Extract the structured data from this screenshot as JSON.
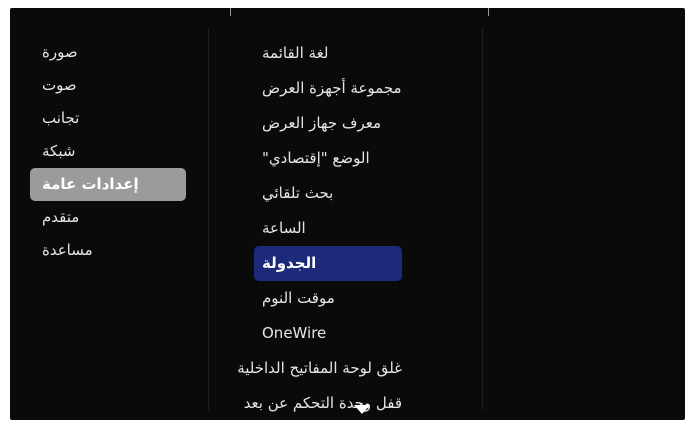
{
  "left_menu": {
    "items": [
      {
        "label": "صورة"
      },
      {
        "label": "صوت"
      },
      {
        "label": "تجانب"
      },
      {
        "label": "شبكة"
      },
      {
        "label": "إعدادات عامة",
        "selected": true
      },
      {
        "label": "متقدم"
      },
      {
        "label": "مساعدة"
      }
    ]
  },
  "submenu": {
    "items": [
      {
        "label": "لغة القائمة"
      },
      {
        "label": "مجموعة أجهزة العرض"
      },
      {
        "label": "معرف جهاز العرض"
      },
      {
        "label": "الوضع \"إقتصادي\""
      },
      {
        "label": "بحث تلقائي"
      },
      {
        "label": "الساعة"
      },
      {
        "label": "الجدولة",
        "selected": true
      },
      {
        "label": "موقت النوم"
      },
      {
        "label": "OneWire"
      },
      {
        "label": "غلق لوحة المفاتيح الداخلية"
      },
      {
        "label": "قفل وحدة التحكم عن بعد"
      }
    ],
    "more_icon": "chevron-down-icon"
  },
  "colors": {
    "background": "#0a0a0a",
    "left_selected": "#9b9b9b",
    "sub_selected": "#1d2a7a",
    "text": "#e6e6e6"
  }
}
